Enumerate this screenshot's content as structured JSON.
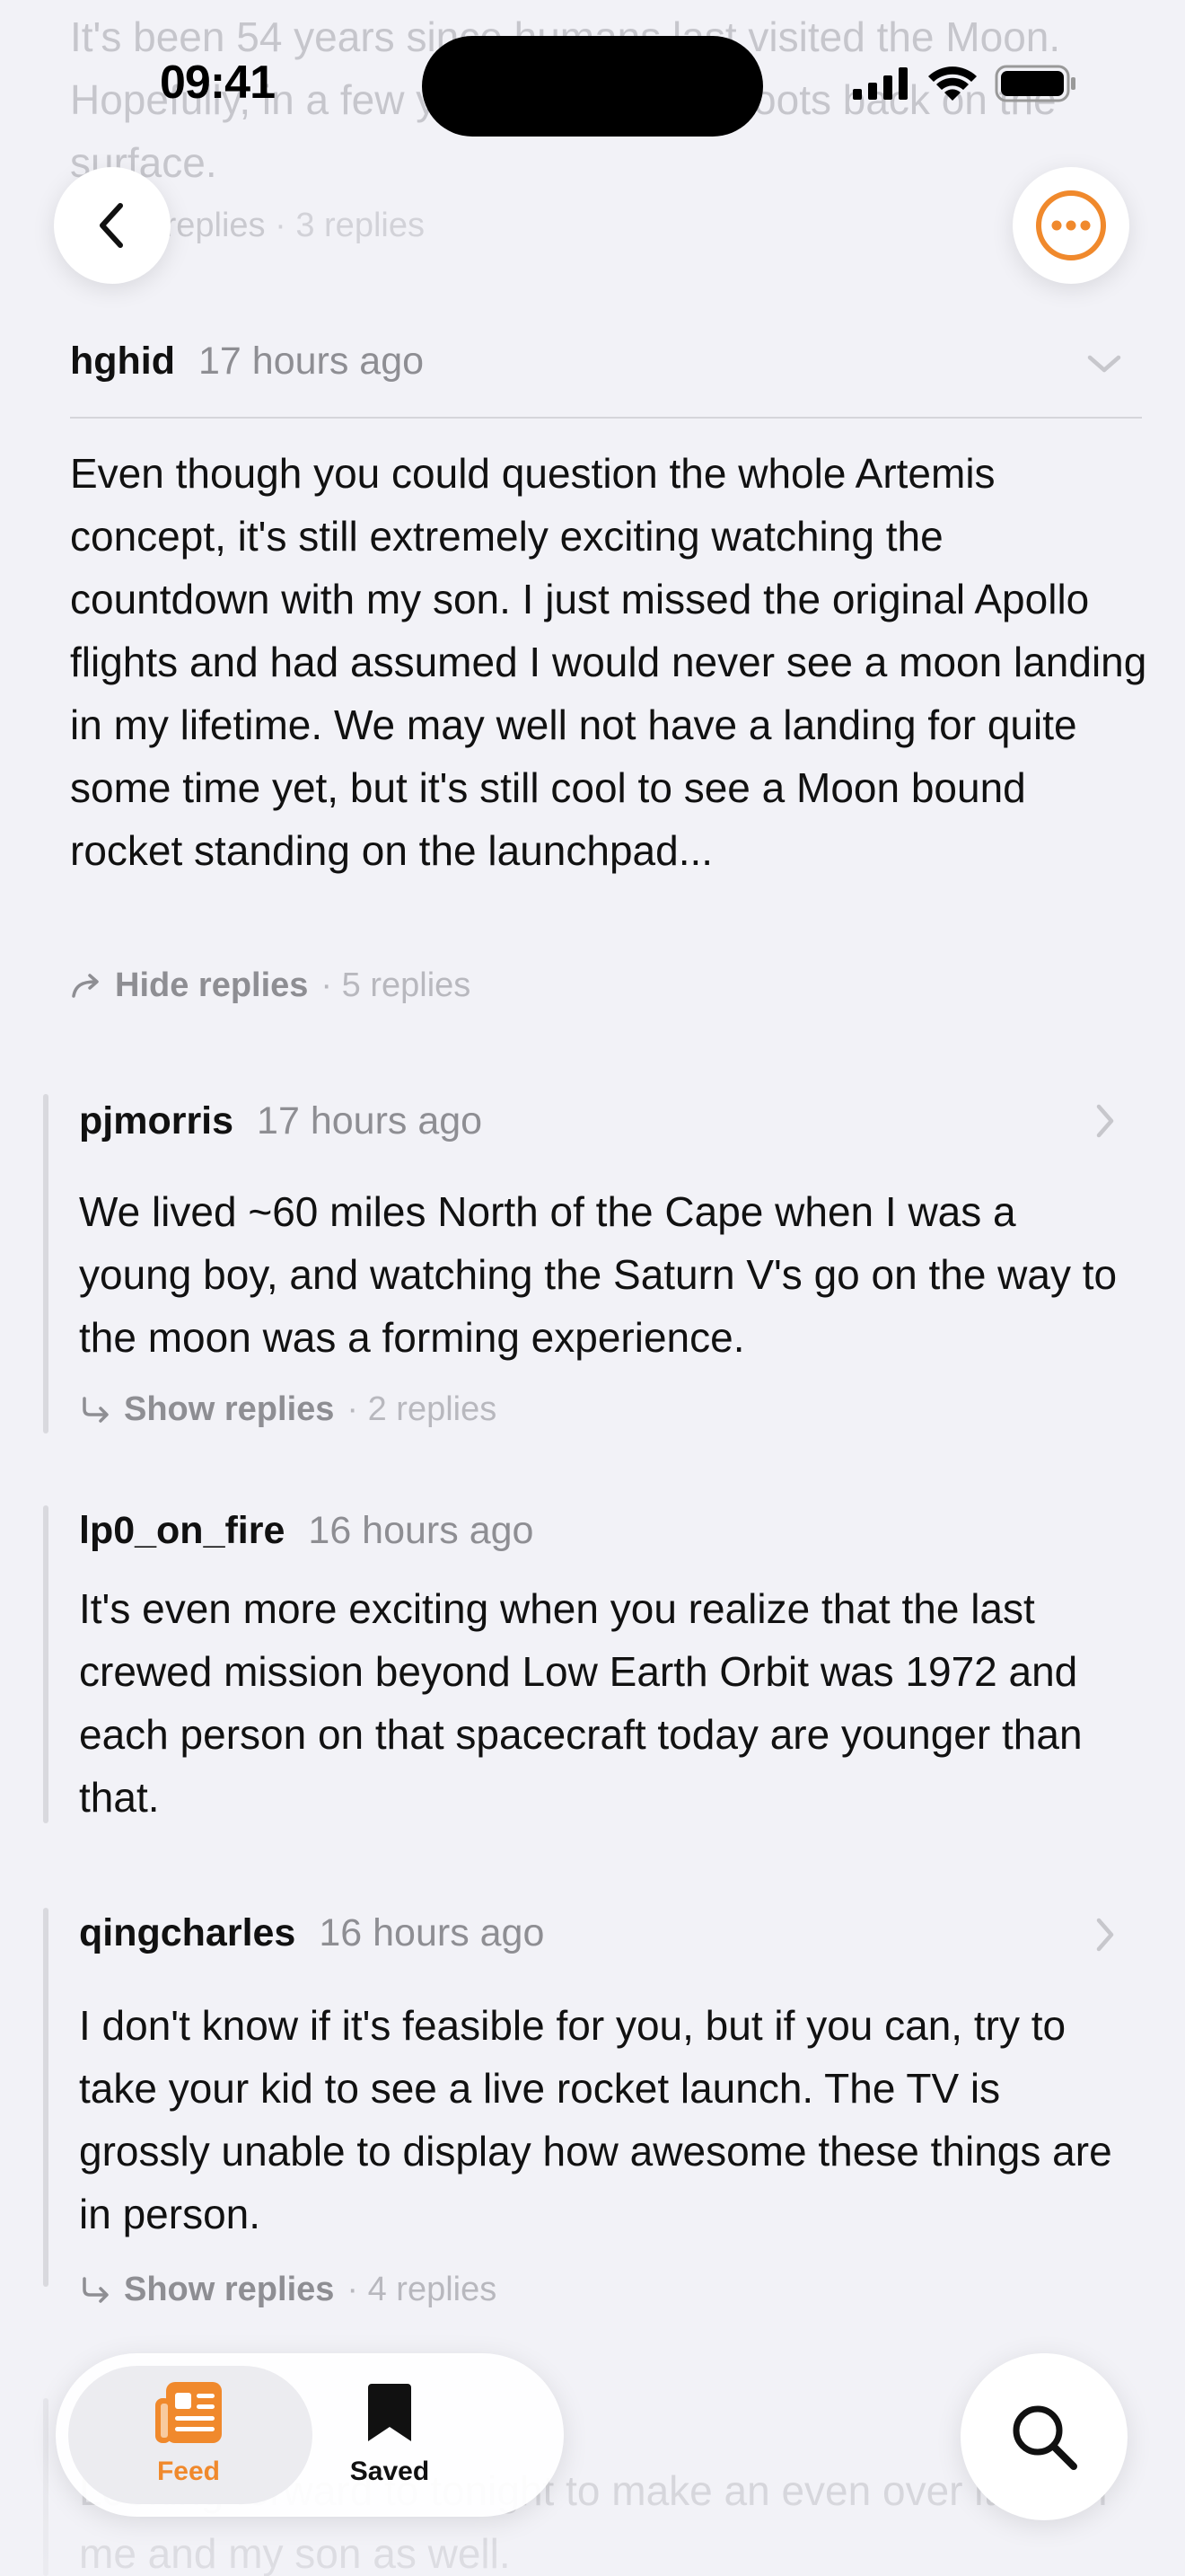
{
  "status_bar": {
    "time": "09:41"
  },
  "top_partial": {
    "text": "It's been 54 years since humans last visited the Moon. Hopefully, in a few years we will get boots back on the surface.",
    "replies_action": "Show replies",
    "replies_count": "· 3 replies"
  },
  "main_comment": {
    "user": "hghid",
    "time": "17 hours ago",
    "body": "Even though you could question the whole Artemis concept, it's still extremely exciting watching the countdown with my son. I just missed the original Apollo flights and had assumed I would never see a moon landing in my lifetime. We may well not have a landing for quite some time yet, but it's still cool to see a Moon bound rocket standing on the launchpad...",
    "replies_action": "Hide replies",
    "replies_count": "· 5 replies"
  },
  "replies": [
    {
      "user": "pjmorris",
      "time": "17 hours ago",
      "body": "We lived ~60 miles North of the Cape when I was a young boy, and watching the Saturn V's go on the way to the moon was a forming experience.",
      "replies_action": "Show replies",
      "replies_count": "· 2 replies"
    },
    {
      "user": "lp0_on_fire",
      "time": "16 hours ago",
      "body": "It's even more exciting when you realize that the last crewed mission beyond Low Earth Orbit was 1972 and each person on that spacecraft today are younger than that."
    },
    {
      "user": "qingcharles",
      "time": "16 hours ago",
      "body": "I don't know if it's feasible for you, but if you can, try to take your kid to see a live rocket launch. The TV is grossly unable to display how awesome these things are in person.",
      "replies_action": "Show replies",
      "replies_count": "· 4 replies"
    }
  ],
  "bottom_partial": {
    "text": "Looking forward to tonight to make an even over it. ... for me and my son as well."
  },
  "tabbar": {
    "feed_label": "Feed",
    "saved_label": "Saved"
  },
  "colors": {
    "accent": "#f0892c",
    "background": "#f2f2f7"
  },
  "icons": {
    "back": "chevron-left-icon",
    "more": "ellipsis-circle-icon",
    "collapse": "chevron-down-icon",
    "open_thread": "chevron-right-icon",
    "replies": "reply-arrow-icon",
    "feed": "newspaper-icon",
    "saved": "bookmark-icon",
    "search": "magnifier-icon"
  }
}
